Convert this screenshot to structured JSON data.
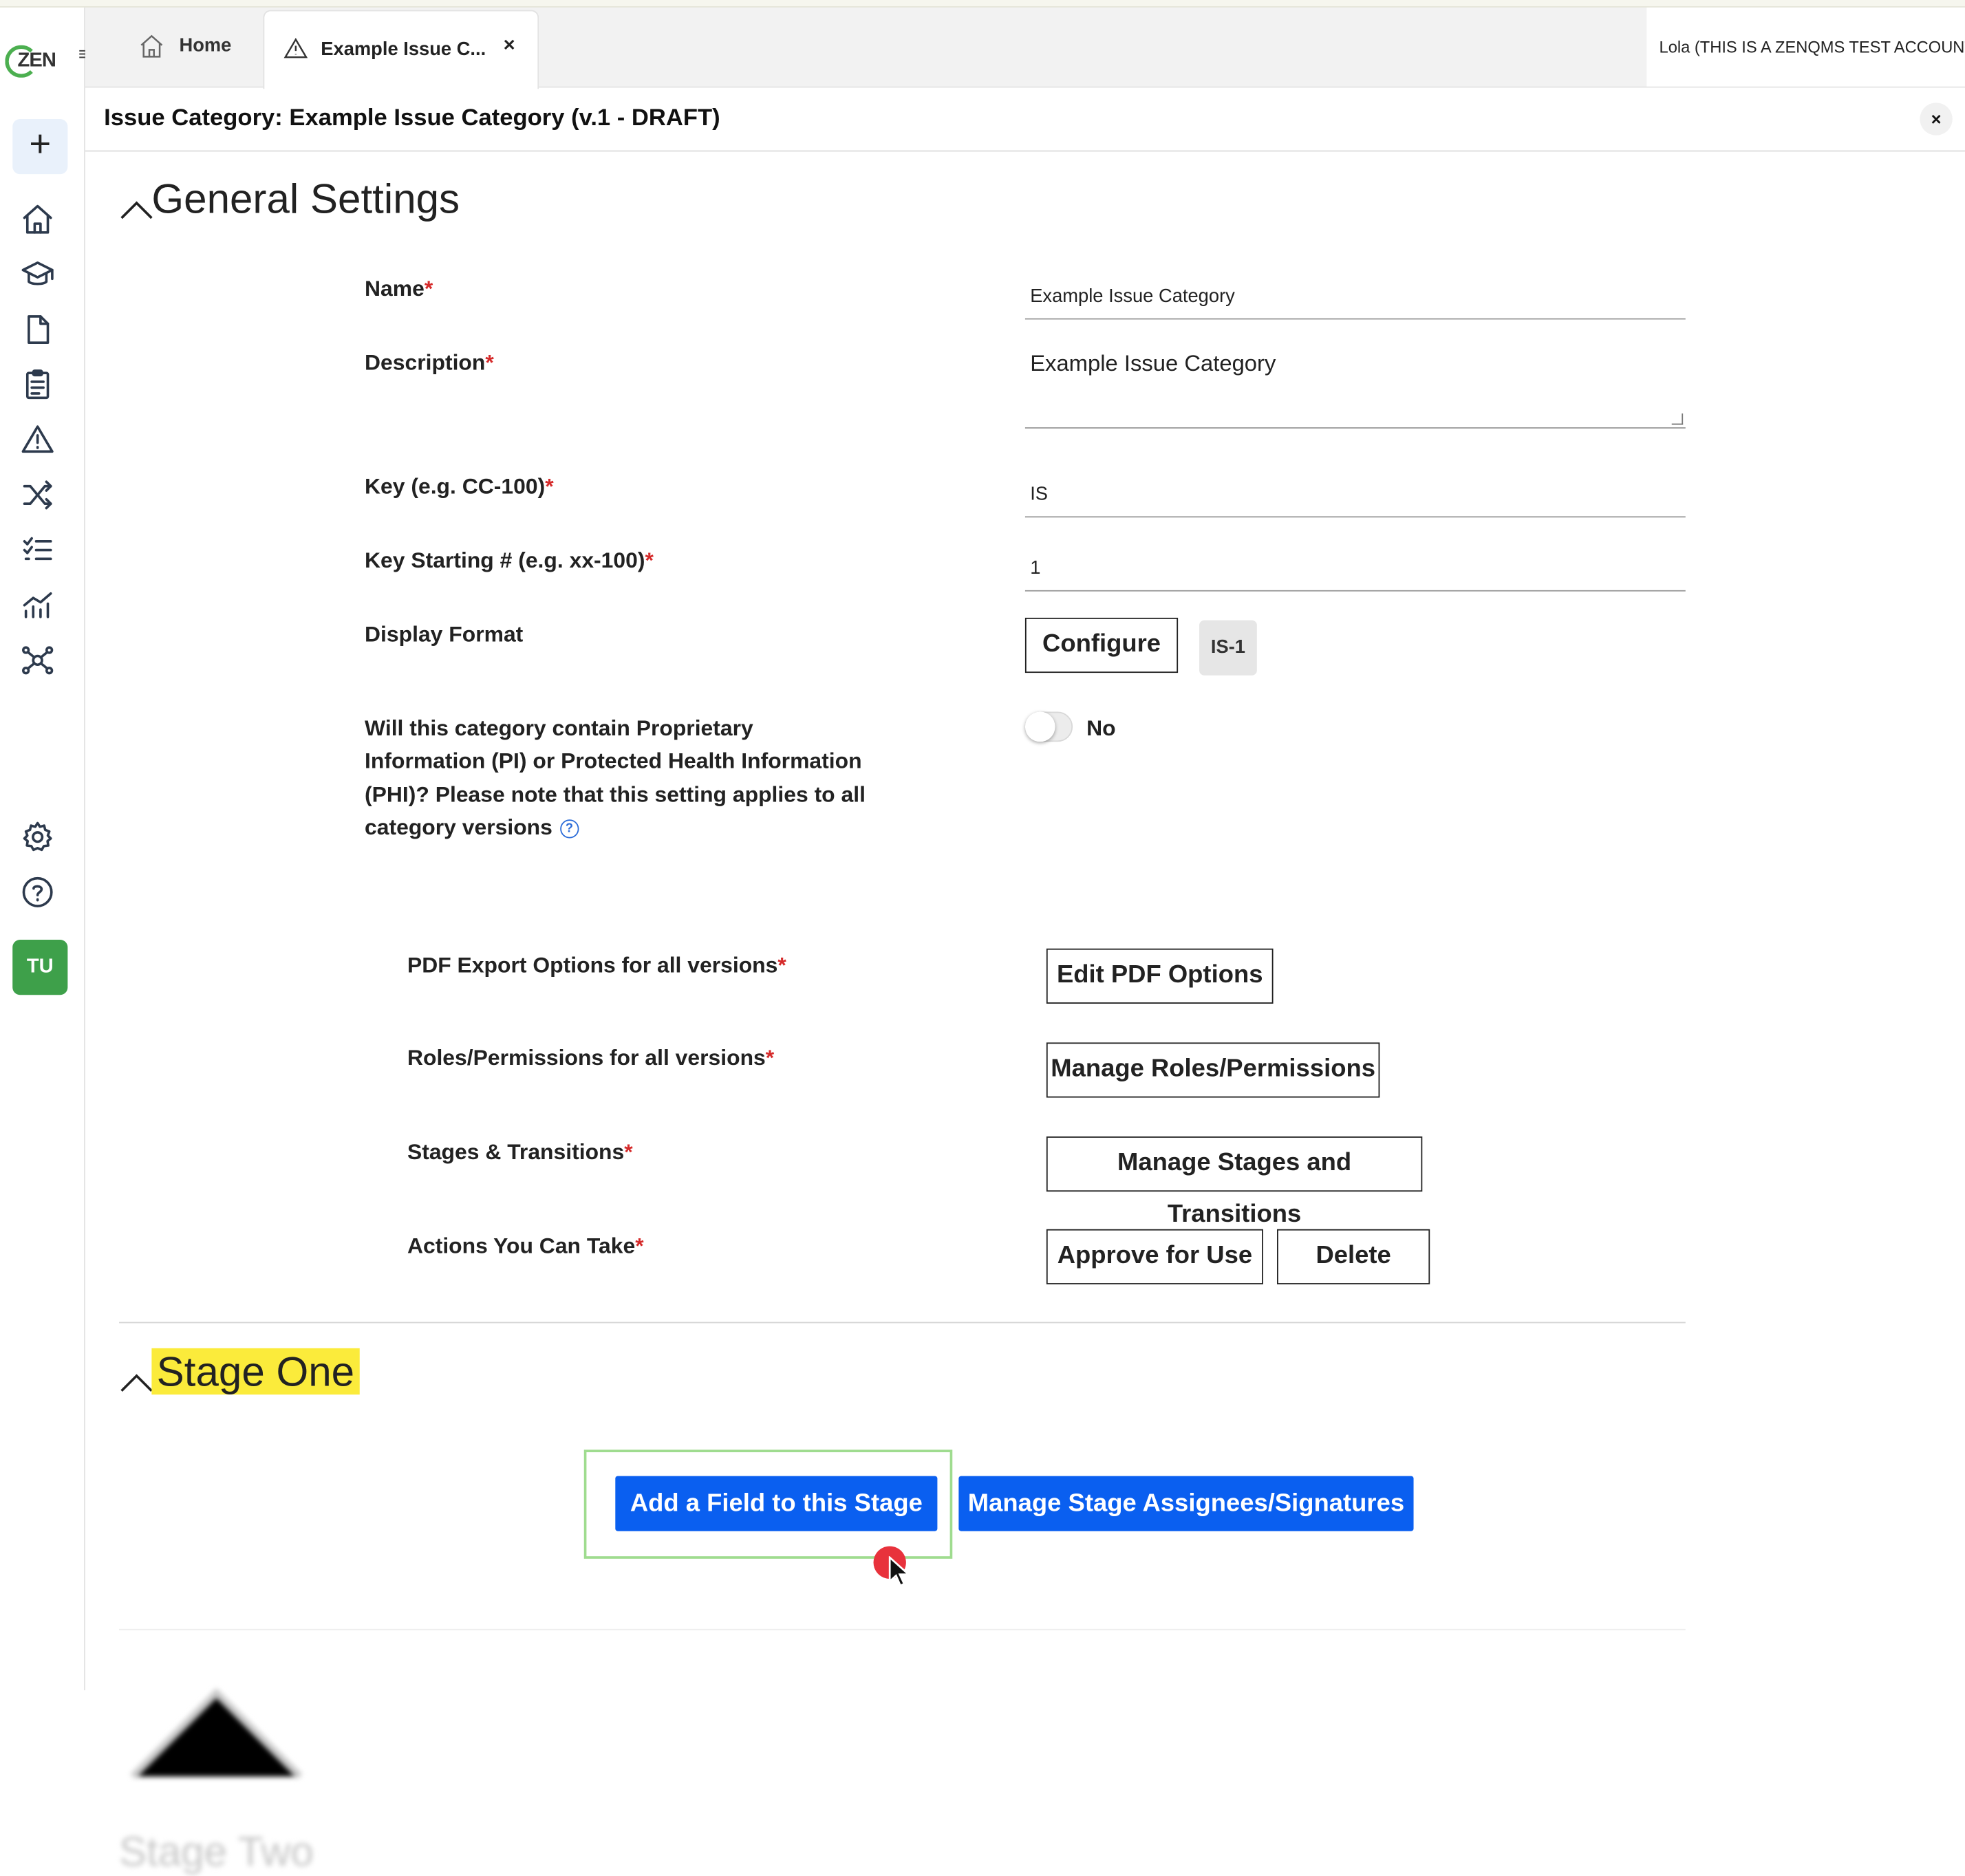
{
  "logo": {
    "text": "ZEN"
  },
  "tabs": [
    {
      "label": "Home",
      "icon": "home-icon"
    },
    {
      "label": "Example Issue C...",
      "icon": "warning-icon",
      "close": "×"
    }
  ],
  "account": {
    "label": "Lola (THIS IS A ZENQMS TEST ACCOUNT)"
  },
  "sidebar": {
    "avatar_initials": "TU",
    "icons": [
      "plus-icon",
      "home-icon",
      "graduation-cap-icon",
      "document-icon",
      "clipboard-icon",
      "warning-icon",
      "shuffle-icon",
      "checklist-icon",
      "chart-icon",
      "network-icon",
      "gear-icon",
      "help-icon"
    ]
  },
  "page": {
    "title": "Issue Category: Example Issue Category (v.1 - DRAFT)",
    "close": "×"
  },
  "general": {
    "heading": "General Settings",
    "name_label": "Name",
    "name_value": "Example Issue Category",
    "description_label": "Description",
    "description_value": "Example Issue Category",
    "key_label": "Key (e.g. CC-100)",
    "key_value": "IS",
    "key_start_label": "Key Starting # (e.g. xx-100)",
    "key_start_value": "1",
    "display_format_label": "Display Format",
    "configure_label": "Configure",
    "display_format_preview": "IS-1",
    "pi_question": "Will this category contain Proprietary Information (PI) or Protected Health Information (PHI)? Please note that this setting applies to all category versions",
    "pi_toggle_label": "No",
    "pdf_label": "PDF Export Options for all versions",
    "pdf_button": "Edit PDF Options",
    "roles_label": "Roles/Permissions for all versions",
    "roles_button": "Manage Roles/Permissions",
    "stages_label": "Stages & Transitions",
    "stages_button": "Manage Stages and Transitions",
    "actions_label": "Actions You Can Take",
    "approve_button": "Approve for Use",
    "delete_button": "Delete",
    "required_mark": "*",
    "help_mark": "?"
  },
  "stage_one": {
    "heading": "Stage One",
    "add_field_button": "Add a Field to this Stage",
    "assignees_button": "Manage Stage Assignees/Signatures"
  },
  "stage_two": {
    "heading": "Stage Two"
  },
  "colors": {
    "primary": "#0a5ff0",
    "highlight": "#fbeb3b",
    "required": "#d52a2a",
    "avatar": "#3ea04a"
  }
}
